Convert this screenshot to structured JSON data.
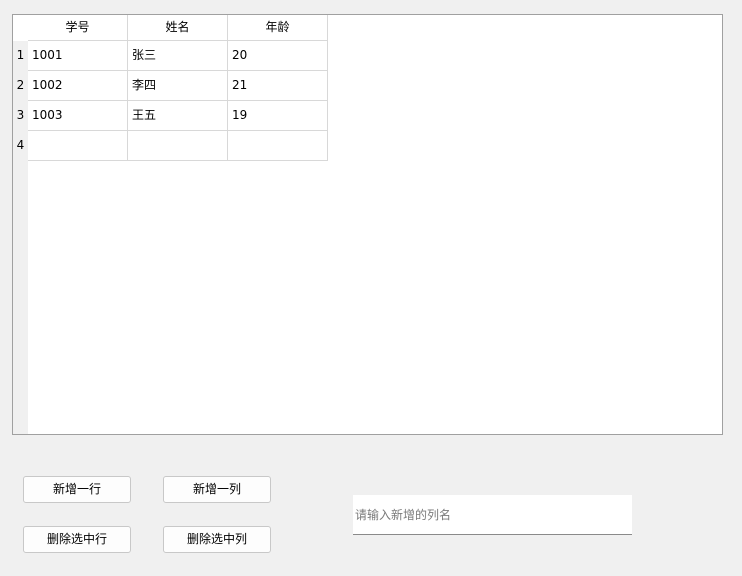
{
  "table": {
    "columns": [
      "学号",
      "姓名",
      "年龄"
    ],
    "row_numbers": [
      "1",
      "2",
      "3",
      "4"
    ],
    "rows": [
      [
        "1001",
        "张三",
        "20"
      ],
      [
        "1002",
        "李四",
        "21"
      ],
      [
        "1003",
        "王五",
        "19"
      ],
      [
        "",
        "",
        ""
      ]
    ]
  },
  "buttons": {
    "add_row": "新增一行",
    "add_column": "新增一列",
    "delete_row": "删除选中行",
    "delete_column": "删除选中列"
  },
  "column_name_input": {
    "value": "",
    "placeholder": "请输入新增的列名"
  }
}
